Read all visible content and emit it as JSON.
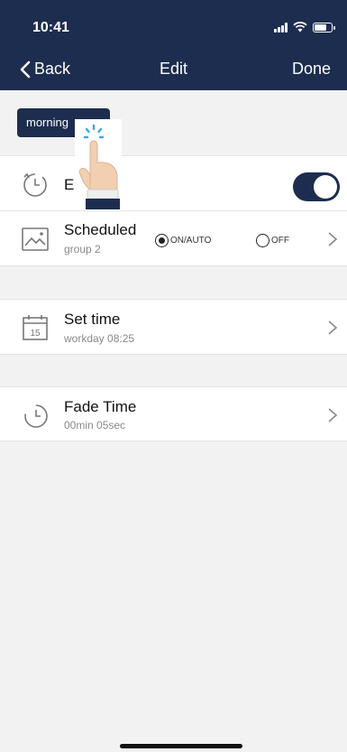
{
  "status": {
    "time": "10:41"
  },
  "nav": {
    "back_label": "Back",
    "title": "Edit",
    "done_label": "Done"
  },
  "scene": {
    "name": "morning"
  },
  "enable": {
    "label": "En",
    "enabled": true
  },
  "scheduled": {
    "title": "Scheduled",
    "subtitle": "group 2",
    "options": [
      "ON/AUTO",
      "OFF"
    ],
    "selected": "ON/AUTO"
  },
  "set_time": {
    "title": "Set time",
    "subtitle": "workday 08:25",
    "calendar_number": "15"
  },
  "fade_time": {
    "title": "Fade Time",
    "subtitle": "00min 05sec"
  },
  "colors": {
    "primary": "#1d2d4f",
    "background": "#f2f2f2"
  }
}
